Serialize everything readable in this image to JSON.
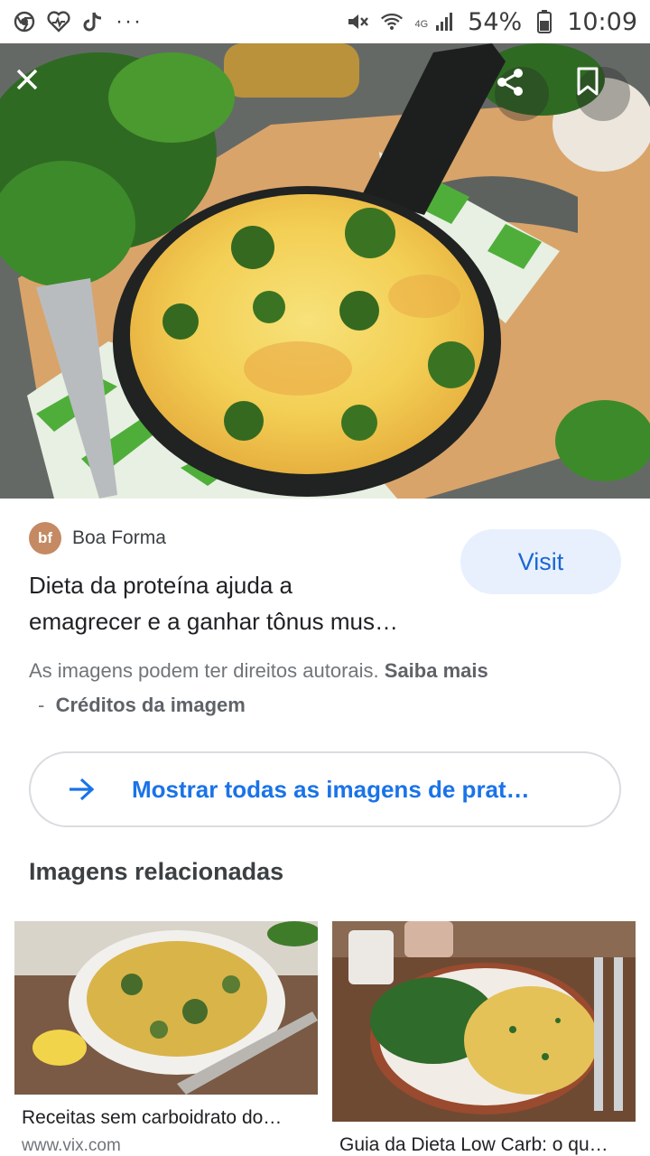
{
  "status_bar": {
    "left_icons": [
      "chrome-icon",
      "health-icon",
      "tiktok-icon"
    ],
    "more": "···",
    "network_type": "4G",
    "battery": "54%",
    "time": "10:09"
  },
  "viewer": {
    "close_icon": "close-icon",
    "share_icon": "share-icon",
    "bookmark_icon": "bookmark-icon"
  },
  "result": {
    "source_logo_text": "bf",
    "source_name": "Boa Forma",
    "title_line1": "Dieta da proteína ajuda a",
    "title_line2": "emagrecer e a ganhar tônus mus…",
    "visit_label": "Visit",
    "copyright_text": "As imagens podem ter direitos autorais.",
    "learn_more": "Saiba mais",
    "separator": "-",
    "credits": "Créditos da imagem"
  },
  "show_all": {
    "label": "Mostrar todas as imagens de prat…"
  },
  "related": {
    "heading": "Imagens relacionadas",
    "items": [
      {
        "title": "Receitas sem carboidrato do…",
        "site": "www.vix.com"
      },
      {
        "title": "Guia da Dieta Low Carb: o qu…",
        "site": ""
      }
    ]
  },
  "colors": {
    "accent": "#1a73e8",
    "visit_bg": "#e8f0fe",
    "source_logo_bg": "#c58a63"
  }
}
